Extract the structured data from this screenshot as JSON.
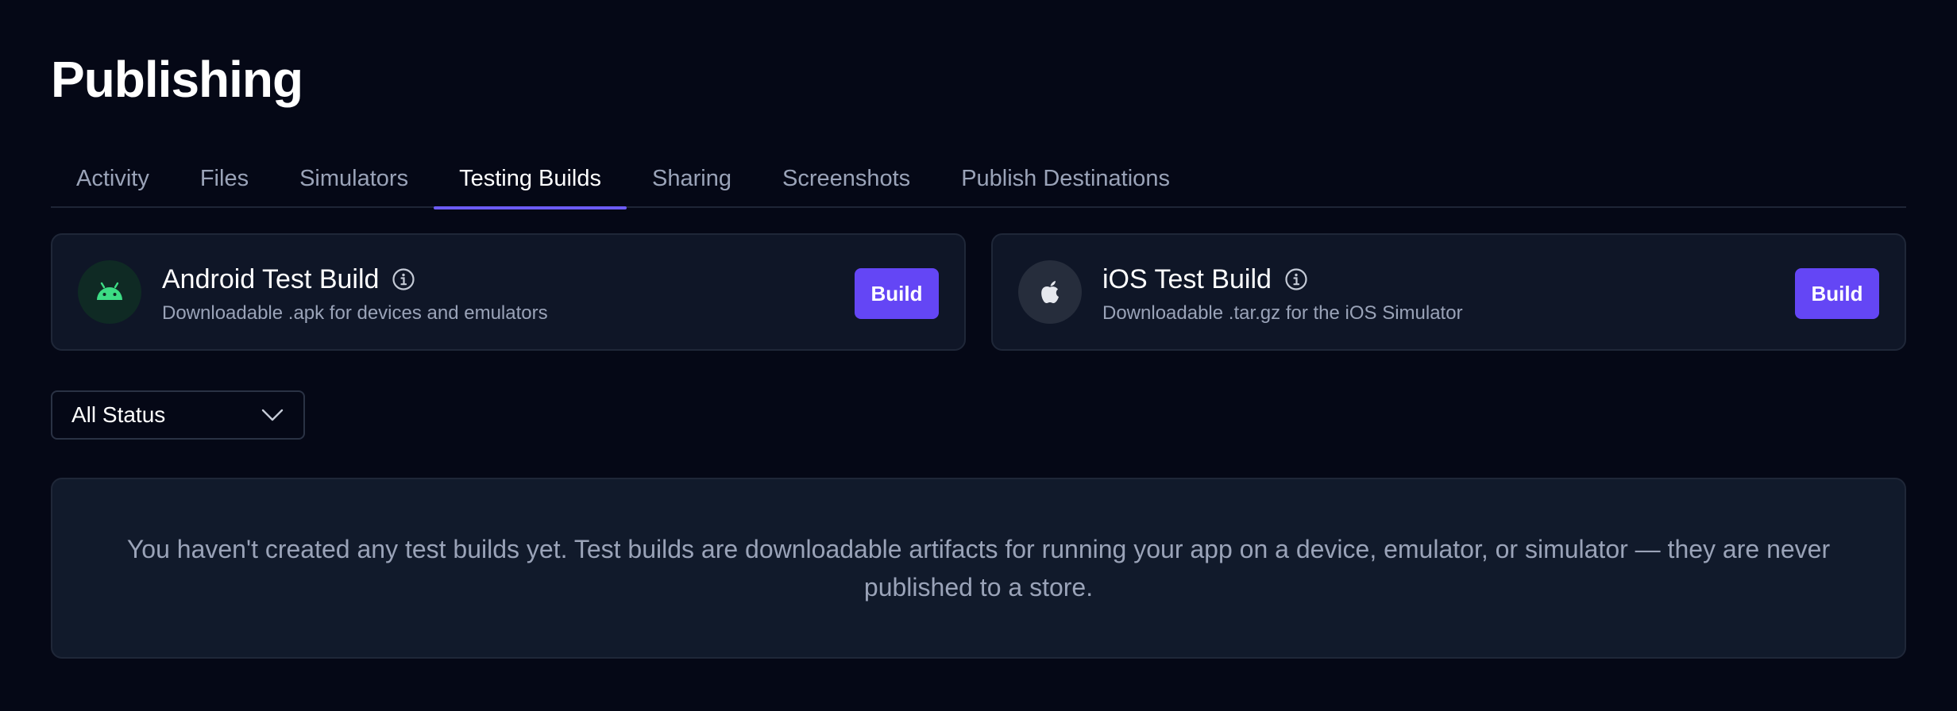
{
  "header": {
    "title": "Publishing"
  },
  "tabs": [
    {
      "label": "Activity",
      "active": false
    },
    {
      "label": "Files",
      "active": false
    },
    {
      "label": "Simulators",
      "active": false
    },
    {
      "label": "Testing Builds",
      "active": true
    },
    {
      "label": "Sharing",
      "active": false
    },
    {
      "label": "Screenshots",
      "active": false
    },
    {
      "label": "Publish Destinations",
      "active": false
    }
  ],
  "builds": {
    "android": {
      "icon": "android-icon",
      "title": "Android Test Build",
      "subtitle": "Downloadable .apk for devices and emulators",
      "button_label": "Build"
    },
    "ios": {
      "icon": "apple-icon",
      "title": "iOS Test Build",
      "subtitle": "Downloadable .tar.gz for the iOS Simulator",
      "button_label": "Build"
    }
  },
  "filter": {
    "selected": "All Status"
  },
  "empty_state": {
    "message": "You haven't created any test builds yet. Test builds are downloadable artifacts for running your app on a device, emulator, or simulator — they are never published to a store."
  },
  "colors": {
    "background": "#050816",
    "accent": "#6446f5",
    "tab_indicator": "#6d5cf6",
    "android_green": "#3ddc84"
  }
}
